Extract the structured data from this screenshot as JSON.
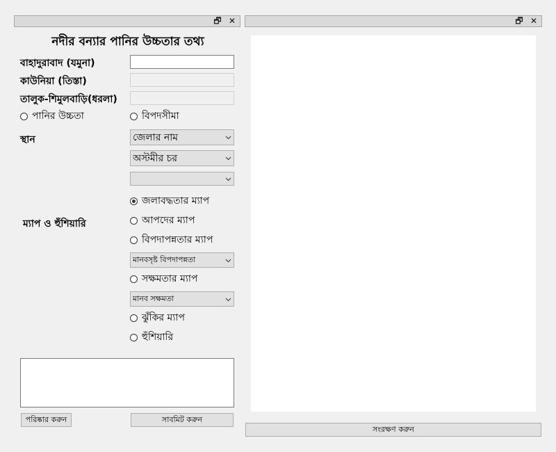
{
  "left_panel": {
    "title": "নদীর বন্যার পানির উচ্চতার তথ্য",
    "stations": [
      {
        "label": "বাহাদুরাবাদ (যমুনা)",
        "value": ""
      },
      {
        "label": "কাউনিয়া (তিস্তা)",
        "value": ""
      },
      {
        "label": "তালুক-শিমুলবাড়ি(ধরলা)",
        "value": ""
      }
    ],
    "mode_radios": [
      {
        "label": "পানির উচ্চতা",
        "checked": false
      },
      {
        "label": "বিপদসীমা",
        "checked": false
      }
    ],
    "location_label": "স্থান",
    "district_select": "জেলার নাম",
    "char_select": "অস্টমীর চর",
    "third_select": "",
    "map_label": "ম্যাপ ও হুঁশিয়ারি",
    "map_options": {
      "waterlogging": "জলাবদ্ধতার ম্যাপ",
      "disaster": "আপদের ম্যাপ",
      "vulnerability": "বিপদাপন্নতার ম্যাপ",
      "vulnerability_select": "মানবসৃষ্ট বিপদাপন্নতা",
      "capacity": "সক্ষমতার ম্যাপ",
      "capacity_select": "মানব সক্ষমতা",
      "risk": "ঝুঁকির ম্যাপ",
      "warning": "হুঁশিয়ারি"
    },
    "selected_map": "waterlogging",
    "clear_button": "পরিষ্কার করুন",
    "submit_button": "সাবমিট করুন"
  },
  "right_panel": {
    "save_button": "সংরক্ষণ করুন"
  },
  "titlebar": {
    "restore_glyph": "🗗",
    "close_glyph": "✕"
  }
}
